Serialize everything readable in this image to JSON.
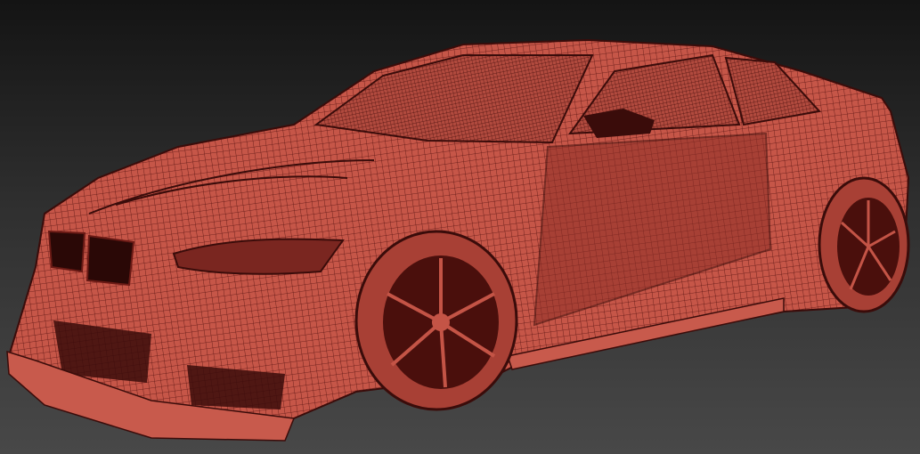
{
  "colors": {
    "background_top": "#141414",
    "background_bottom": "#484848",
    "body": "#c9584a",
    "wire": "#5a1512",
    "dark": "#3a0c0a"
  },
  "icons": [
    "car-wireframe-render"
  ]
}
